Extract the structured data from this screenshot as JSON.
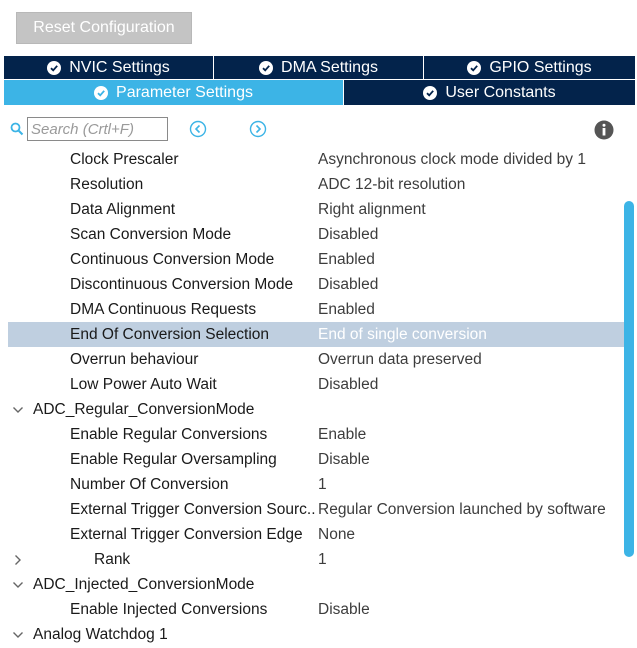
{
  "toolbar": {
    "reset_label": "Reset Configuration"
  },
  "tabs": {
    "row1": [
      {
        "label": "NVIC Settings"
      },
      {
        "label": "DMA Settings"
      },
      {
        "label": "GPIO Settings"
      }
    ],
    "row2": [
      {
        "label": "Parameter Settings",
        "active": true
      },
      {
        "label": "User Constants"
      }
    ]
  },
  "search": {
    "placeholder": "Search (Crtl+F)"
  },
  "colors": {
    "accent": "#3cb4e6",
    "tab_dark": "#03234b",
    "selection": "#bfcfe0"
  },
  "icons": {
    "search": "search-icon",
    "prev": "prev-circle-icon",
    "next": "next-circle-icon",
    "info": "info-icon",
    "check": "check-circle-icon",
    "expanded": "chevron-down-icon",
    "collapsed": "chevron-right-icon"
  },
  "params": [
    {
      "name": "Clock Prescaler",
      "value": "Asynchronous clock mode divided by 1"
    },
    {
      "name": "Resolution",
      "value": "ADC 12-bit resolution"
    },
    {
      "name": "Data Alignment",
      "value": "Right alignment"
    },
    {
      "name": "Scan Conversion Mode",
      "value": "Disabled"
    },
    {
      "name": "Continuous Conversion Mode",
      "value": "Enabled"
    },
    {
      "name": "Discontinuous Conversion Mode",
      "value": "Disabled"
    },
    {
      "name": "DMA Continuous Requests",
      "value": "Enabled"
    },
    {
      "name": "End Of Conversion Selection",
      "value": "End of single conversion",
      "selected": true
    },
    {
      "name": "Overrun behaviour",
      "value": "Overrun data preserved"
    },
    {
      "name": "Low Power Auto Wait",
      "value": "Disabled"
    }
  ],
  "regular_group": {
    "label": "ADC_Regular_ConversionMode",
    "items": [
      {
        "name": "Enable Regular Conversions",
        "value": "Enable"
      },
      {
        "name": "Enable Regular Oversampling",
        "value": "Disable"
      },
      {
        "name": "Number Of Conversion",
        "value": "1"
      },
      {
        "name": "External Trigger Conversion Sourc",
        "ellipsis": "..",
        "value": "Regular Conversion launched by software"
      },
      {
        "name": "External Trigger Conversion Edge",
        "value": "None"
      }
    ],
    "rank": {
      "name": "Rank",
      "value": "1"
    }
  },
  "injected_group": {
    "label": "ADC_Injected_ConversionMode",
    "items": [
      {
        "name": "Enable Injected Conversions",
        "value": "Disable"
      }
    ]
  },
  "watchdog_group": {
    "label": "Analog Watchdog 1"
  }
}
